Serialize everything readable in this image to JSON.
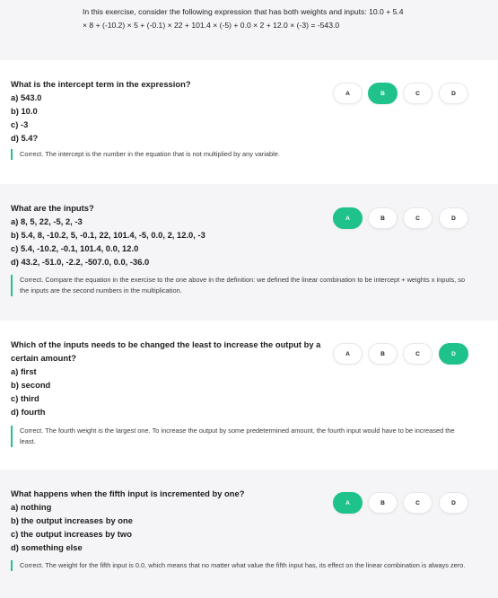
{
  "intro": "In this exercise, consider the following expression that has both weights and inputs: 10.0 + 5.4 × 8 + (-10.2) × 5 + (-0.1) × 22 + 101.4 × (-5) + 0.0 × 2 + 12.0 × (-3) = -543.0",
  "accent": "#1fc28a",
  "questions": [
    {
      "title": "What is the intercept term in the expression?",
      "options": [
        "a) 543.0",
        "b) 10.0",
        "c) -3",
        "d) 5.4?"
      ],
      "buttons": [
        "A",
        "B",
        "C",
        "D"
      ],
      "selected": "B",
      "feedback": "Correct. The intercept is the number in the equation that is not multiplied by any variable."
    },
    {
      "title": "What are the inputs?",
      "options": [
        "a) 8, 5, 22, -5, 2, -3",
        "b) 5.4, 8, -10.2, 5, -0.1, 22, 101.4, -5, 0.0, 2, 12.0, -3",
        "c) 5.4, -10.2, -0.1, 101.4, 0.0, 12.0",
        "d) 43.2, -51.0, -2.2, -507.0, 0.0, -36.0"
      ],
      "buttons": [
        "A",
        "B",
        "C",
        "D"
      ],
      "selected": "A",
      "feedback": "Correct. Compare the equation in the exercise to the one above in the definition: we defined the linear combination to be intercept + weights x inputs, so the inputs are the second numbers in the multiplication."
    },
    {
      "title": "Which of the inputs needs to be changed the least to increase the output by a certain amount?",
      "options": [
        "a) first",
        "b) second",
        "c) third",
        "d) fourth"
      ],
      "buttons": [
        "A",
        "B",
        "C",
        "D"
      ],
      "selected": "D",
      "feedback": "Correct. The fourth weight is the largest one. To increase the output by some predetermined amount, the fourth input would have to be increased the least."
    },
    {
      "title": "What happens when the fifth input is incremented by one?",
      "options": [
        "a) nothing",
        "b) the output increases by one",
        "c) the output increases by two",
        "d) something else"
      ],
      "buttons": [
        "A",
        "B",
        "C",
        "D"
      ],
      "selected": "A",
      "feedback": "Correct. The weight for the fifth input is 0.0, which means that no matter what value the fifth input has, its effect on the linear combination is always zero."
    }
  ]
}
